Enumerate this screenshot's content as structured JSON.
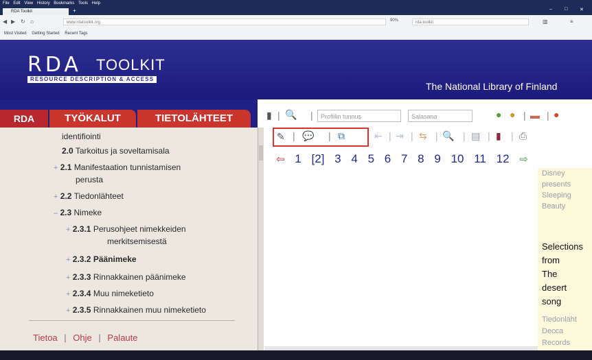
{
  "browser": {
    "menu": [
      "File",
      "Edit",
      "View",
      "History",
      "Bookmarks",
      "Tools",
      "Help"
    ],
    "tab_title": "RDA Toolkit",
    "new_tab": "+",
    "window_controls": [
      "–",
      "□",
      "✕"
    ],
    "url": "www.rdatoolkit.org",
    "zoom": "90%",
    "search_placeholder": "rda toolkit",
    "bookmarks": [
      "Most Visited",
      "Getting Started",
      "Recent Tags"
    ]
  },
  "banner": {
    "logo_rda": "RDA",
    "logo_toolkit": "TOOLKIT",
    "tagline": "RESOURCE DESCRIPTION & ACCESS",
    "institution": "The National Library of Finland"
  },
  "left_tabs": {
    "rda": "RDA",
    "tools": "TYÖKALUT",
    "resources": "TIETOLÄHTEET"
  },
  "toc": [
    {
      "prefix": "",
      "num": "",
      "label": "identifiointi",
      "indent": 0
    },
    {
      "prefix": "",
      "num": "2.0",
      "label": "Tarkoitus ja soveltamisala",
      "indent": 0
    },
    {
      "prefix": "+",
      "num": "2.1",
      "label": "Manifestaation tunnistamisen",
      "cont": "perusta",
      "indent": 0
    },
    {
      "prefix": "+",
      "num": "2.2",
      "label": "Tiedonlähteet",
      "indent": 0
    },
    {
      "prefix": "–",
      "num": "2.3",
      "label": "Nimeke",
      "indent": 0
    },
    {
      "prefix": "+",
      "num": "2.3.1",
      "label": "Perusohjeet nimekkeiden",
      "cont": "merkitsemisestä",
      "indent": 1
    },
    {
      "prefix": "+",
      "num": "2.3.2",
      "label": "Päänimeke",
      "indent": 1
    },
    {
      "prefix": "+",
      "num": "2.3.3",
      "label": "Rinnakkainen päänimeke",
      "indent": 1
    },
    {
      "prefix": "+",
      "num": "2.3.4",
      "label": "Muu nimeketieto",
      "indent": 1
    },
    {
      "prefix": "+",
      "num": "2.3.5",
      "label": "Rinnakkainen muu nimeketieto",
      "indent": 1
    }
  ],
  "footer": {
    "about": "Tietoa",
    "help": "Ohje",
    "feedback": "Palaute",
    "separator": "|"
  },
  "toolbar": {
    "profile_placeholder": "Profiilin tunnus",
    "password_placeholder": "Salasana"
  },
  "pagination": {
    "pages": [
      "1",
      "[2]",
      "3",
      "4",
      "5",
      "6",
      "7",
      "8",
      "9",
      "10",
      "11",
      "12"
    ]
  },
  "results": {
    "item1": [
      "Disney",
      "presents",
      "Sleeping",
      "Beauty"
    ],
    "item2": [
      "Selections",
      "from",
      "The",
      "desert",
      "song"
    ],
    "item2_meta": [
      "Tiedonläht",
      "Decca",
      "Records"
    ]
  },
  "colors": {
    "banner": "#2e2e92",
    "tab_red": "#c9342d",
    "left_panel": "#ece7df",
    "link_red": "#b8394a",
    "page_link": "#1e2a8a",
    "result_bg": "#fbf8dc",
    "highlight_box": "#dd3333"
  }
}
